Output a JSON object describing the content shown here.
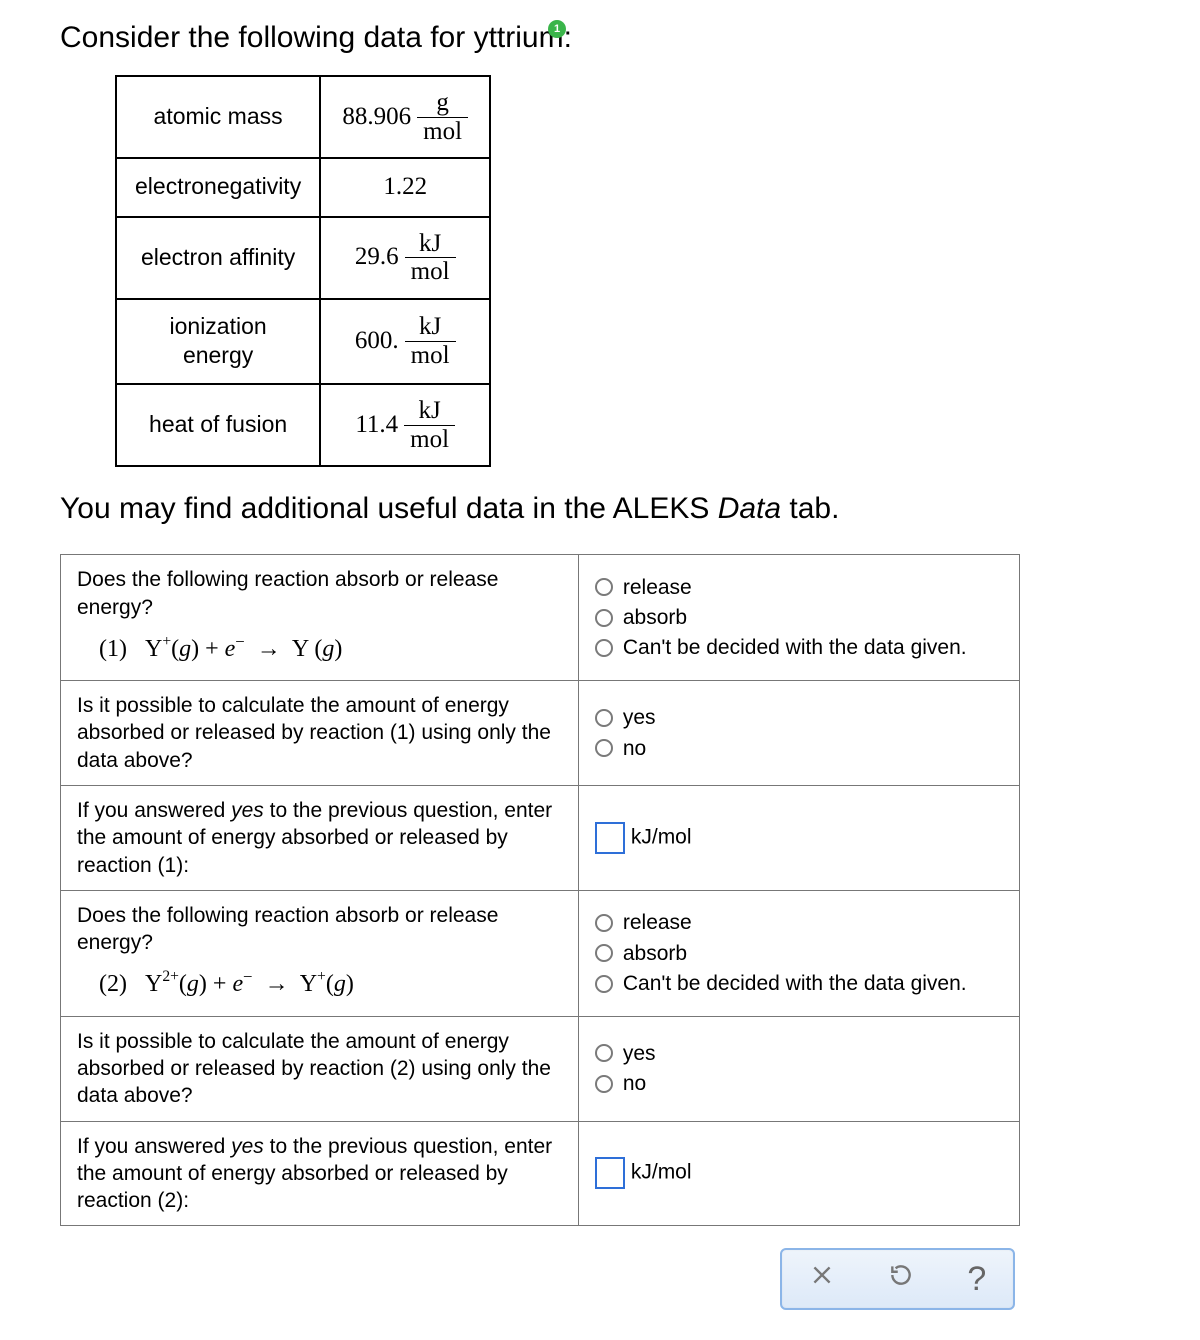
{
  "intro": "Consider the following data for yttrium:",
  "tooltip_no": "1",
  "properties": [
    {
      "label": "atomic mass",
      "value": "88.906",
      "num": "g",
      "den": "mol"
    },
    {
      "label": "electronegativity",
      "value": "1.22",
      "num": "",
      "den": ""
    },
    {
      "label": "electron affinity",
      "value": "29.6",
      "num": "kJ",
      "den": "mol"
    },
    {
      "label": "ionization energy",
      "value": "600.",
      "num": "kJ",
      "den": "mol"
    },
    {
      "label": "heat of fusion",
      "value": "11.4",
      "num": "kJ",
      "den": "mol"
    }
  ],
  "addl_pre": "You may find additional useful data in the ALEKS ",
  "addl_ital": "Data",
  "addl_post": " tab.",
  "q1": {
    "prompt": "Does the following reaction absorb or release energy?",
    "eqn_num": "(1)",
    "opts": [
      "release",
      "absorb",
      "Can't be decided with the data given."
    ]
  },
  "q2": {
    "prompt": "Is it possible to calculate the amount of energy absorbed or released by reaction (1) using only the data above?",
    "opts": [
      "yes",
      "no"
    ]
  },
  "q3": {
    "prompt_pre": "If you answered ",
    "prompt_ital": "yes",
    "prompt_post": " to the previous question, enter the amount of energy absorbed or released by reaction (1):",
    "unit": "kJ/mol"
  },
  "q4": {
    "prompt": "Does the following reaction absorb or release energy?",
    "eqn_num": "(2)",
    "opts": [
      "release",
      "absorb",
      "Can't be decided with the data given."
    ]
  },
  "q5": {
    "prompt": "Is it possible to calculate the amount of energy absorbed or released by reaction (2) using only the data above?",
    "opts": [
      "yes",
      "no"
    ]
  },
  "q6": {
    "prompt_pre": "If you answered ",
    "prompt_ital": "yes",
    "prompt_post": " to the previous question, enter the amount of energy absorbed or released by reaction (2):",
    "unit": "kJ/mol"
  },
  "help_char": "?"
}
